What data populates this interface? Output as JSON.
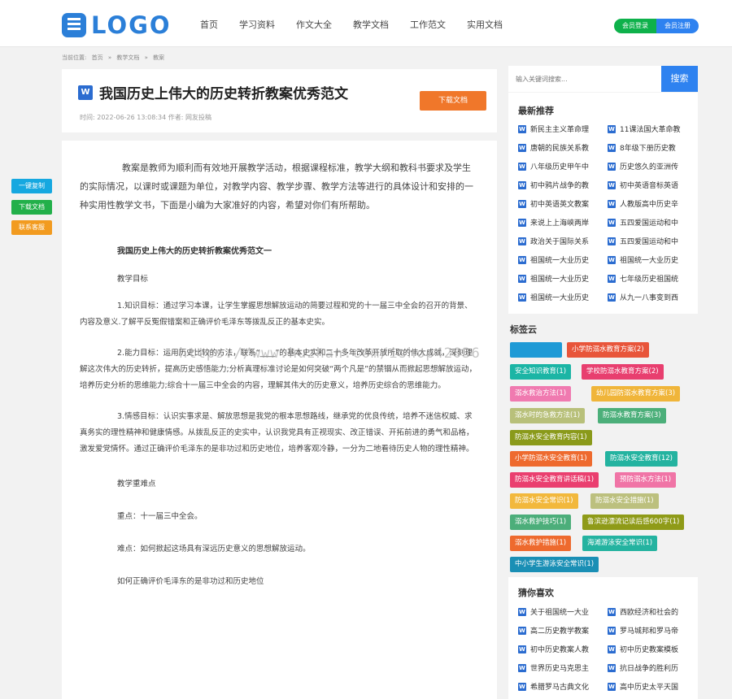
{
  "header": {
    "logo_text": "LOGO",
    "nav": [
      "首页",
      "学习资料",
      "作文大全",
      "教学文档",
      "工作范文",
      "实用文档"
    ],
    "login_label": "会员登录",
    "register_label": "会员注册"
  },
  "breadcrumb": {
    "prefix": "当前位置:",
    "items": [
      "首页",
      "»",
      "教学文档",
      "»",
      "教案"
    ]
  },
  "doc": {
    "icon_letter": "W",
    "title": "我国历史上伟大的历史转折教案优秀范文",
    "meta": "时间: 2022-06-26 13:08:34   作者: 网友投稿",
    "download_label": "下载文档"
  },
  "article": {
    "intro": "教案是教师为顺利而有效地开展教学活动，根据课程标准，教学大纲和教科书要求及学生的实际情况，以课时或课题为单位，对教学内容、教学步骤、教学方法等进行的具体设计和安排的一种实用性教学文书，下面是小编为大家准好的内容，希望对你们有所帮助。",
    "heading": "我国历史上伟大的历史转折教案优秀范文一",
    "goal_label": "教学目标",
    "p1": "1.知识目标：通过学习本课，让学生掌握思想解放运动的简要过程和党的十一届三中全会的召开的背景、内容及意义.了解平反冤假错案和正确评价毛泽东等拨乱反正的基本史实。",
    "p2": "2.能力目标：运用历史比较的方法，联系“____”的基本史实和二十多年改革开放所取的伟大成就，深刻理解这次伟大的历史转折，提高历史感悟能力;分析真理标准讨论是如何突破“两个凡是”的禁锢从而掀起思想解放运动，培养历史分析的思维能力;综合十一届三中全会的内容，理解其伟大的历史意义，培养历史综合的思维能力。",
    "p3": "3.情感目标：认识实事求是、解放思想是我党的根本思想路线，继承党的优良传统，培养不迷信权威、求真务实的理性精神和健康情感。从拨乱反正的史实中，认识我党具有正视现实、改正错误、开拓前进的勇气和品格，激发爱党情怀。通过正确评价毛泽东的是非功过和历史地位，培养客观冷静，一分为二地看待历史人物的理性精神。",
    "key_label": "教学重难点",
    "key_point": "重点：十一届三中全会。",
    "difficult_point": "难点：如何掀起这场具有深远历史意义的思想解放运动。",
    "last_line": "如何正确评价毛泽东的是非功过和历史地位",
    "watermark": "https://www.huzhan.com/ishop42036"
  },
  "side_buttons": [
    {
      "label": "一键复制",
      "color": "#16a8e0"
    },
    {
      "label": "下载文档",
      "color": "#22b04a"
    },
    {
      "label": "联系客服",
      "color": "#f29b20"
    }
  ],
  "search": {
    "placeholder": "输入关键词搜索...",
    "button_label": "搜索"
  },
  "recommend": {
    "title": "最新推荐",
    "items": [
      "新民主主义革命理",
      "11课法国大革命教",
      "唐朝的民族关系教",
      "8年级下册历史教",
      "八年级历史甲午中",
      "历史悠久的亚洲传",
      "初中鸦片战争的教",
      "初中英语音标英语",
      "初中英语英文教案",
      "人教版高中历史辛",
      "来说上上海峡两岸",
      "五四爱国运动和中",
      "政治关于国际关系",
      "五四爱国运动和中",
      "祖国统一大业历史",
      "祖国统一大业历史",
      "祖国统一大业历史",
      "七年级历史祖国统",
      "祖国统一大业历史",
      "从九一八事变到西"
    ]
  },
  "tags": {
    "title": "标签云",
    "items": [
      {
        "label": "小学防溺水教育方案(2)",
        "color": "#e8553a"
      },
      {
        "label": "安全知识教育(1)",
        "color": "#1bb5a5"
      },
      {
        "label": "学校防溺水教育方案(2)",
        "color": "#e83f6f"
      },
      {
        "label": "溺水救治方法(1)",
        "color": "#f07ab0"
      },
      {
        "label": "幼儿园防溺水教育方案(3)",
        "color": "#f0b53a"
      },
      {
        "label": "溺水时的急救方法(1)",
        "color": "#b8c07a"
      },
      {
        "label": "防溺水教育方案(3)",
        "color": "#4caf7a"
      },
      {
        "label": "防溺水安全教育内容(1)",
        "color": "#8a9a1a"
      },
      {
        "label": "小学防溺水安全教育(1)",
        "color": "#ee6a2e"
      },
      {
        "label": "防溺水安全教育(12)",
        "color": "#24b3a0"
      },
      {
        "label": "防溺水安全教育讲话稿(1)",
        "color": "#ea3f6f"
      },
      {
        "label": "预防溺水方法(1)",
        "color": "#f074a6"
      },
      {
        "label": "防溺水安全常识(1)",
        "color": "#f2b83c"
      },
      {
        "label": "防溺水安全措施(1)",
        "color": "#bcc07e"
      },
      {
        "label": "溺水救护技巧(1)",
        "color": "#4cae7a"
      },
      {
        "label": "鲁滨逊漂流记读后感600字(1)",
        "color": "#8f9b18"
      },
      {
        "label": "溺水救护措施(1)",
        "color": "#ee6a2e"
      },
      {
        "label": "海滩游泳安全常识(1)",
        "color": "#24b3a0"
      },
      {
        "label": "中小学生游泳安全常识(1)",
        "color": "#1a8fb5"
      }
    ]
  },
  "guess": {
    "title": "猜你喜欢",
    "items": [
      "关于祖国统一大业",
      "西欧经济和社会的",
      "高二历史教学教案",
      "罗马城邦和罗马帝",
      "初中历史教案人教",
      "初中历史教案模板",
      "世界历史马克思主",
      "抗日战争的胜利历",
      "希腊罗马古典文化",
      "高中历史太平天国"
    ]
  }
}
